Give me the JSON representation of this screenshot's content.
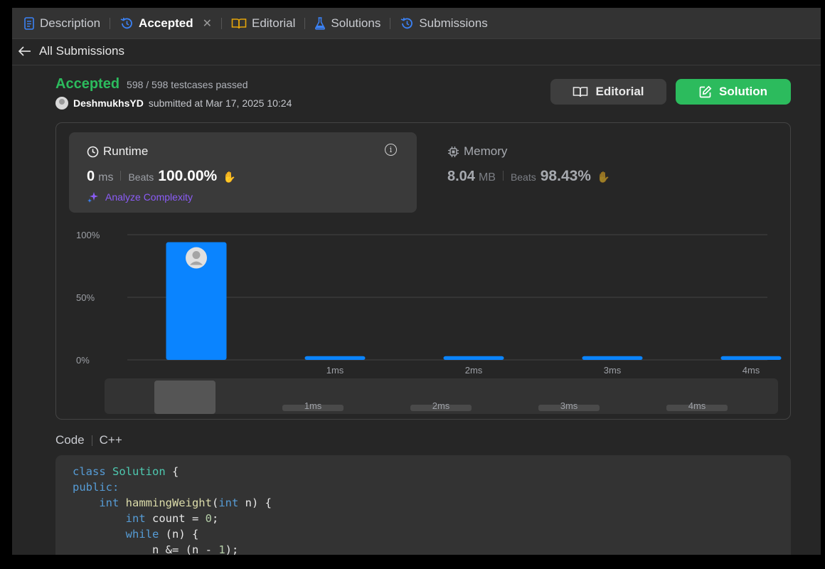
{
  "tabs": [
    {
      "label": "Description",
      "icon": "document-icon"
    },
    {
      "label": "Accepted",
      "icon": "history-icon",
      "active": true
    },
    {
      "label": "Editorial",
      "icon": "book-icon"
    },
    {
      "label": "Solutions",
      "icon": "flask-icon"
    },
    {
      "label": "Submissions",
      "icon": "history-icon"
    }
  ],
  "back_link": {
    "label": "All Submissions"
  },
  "submission": {
    "status": "Accepted",
    "testcases": "598 / 598 testcases passed",
    "username": "DeshmukhsYD",
    "submitted_text": "submitted at Mar 17, 2025 10:24"
  },
  "buttons": {
    "editorial": "Editorial",
    "solution": "Solution"
  },
  "runtime": {
    "label": "Runtime",
    "value": "0",
    "unit": "ms",
    "beats_label": "Beats",
    "beats_pct": "100.00%",
    "analyze_label": "Analyze Complexity"
  },
  "memory": {
    "label": "Memory",
    "value": "8.04",
    "unit": "MB",
    "beats_label": "Beats",
    "beats_pct": "98.43%"
  },
  "colors": {
    "accent_green": "#2cbb5d",
    "bar_blue": "#0a84ff",
    "analyze_purple": "#8b5cf6"
  },
  "chart_data": {
    "type": "bar",
    "categories": [
      "0ms",
      "1ms",
      "2ms",
      "3ms",
      "4ms"
    ],
    "tick_labels": [
      "",
      "1ms",
      "2ms",
      "3ms",
      "4ms"
    ],
    "values": [
      94,
      3,
      3,
      3,
      3
    ],
    "yticks": [
      "100%",
      "50%",
      "0%"
    ],
    "ylim": [
      0,
      100
    ],
    "grid": true,
    "highlight_index": 0,
    "overview_tick_labels": [
      "1ms",
      "2ms",
      "3ms",
      "4ms"
    ]
  },
  "code_section": {
    "label": "Code",
    "language": "C++",
    "lines": [
      [
        {
          "t": "class ",
          "c": "kw"
        },
        {
          "t": "Solution",
          "c": "ty"
        },
        {
          "t": " {",
          "c": ""
        }
      ],
      [
        {
          "t": "public:",
          "c": "kw"
        }
      ],
      [
        {
          "t": "    int ",
          "c": "kw"
        },
        {
          "t": "hammingWeight",
          "c": "fn"
        },
        {
          "t": "(",
          "c": ""
        },
        {
          "t": "int",
          "c": "kw"
        },
        {
          "t": " n) {",
          "c": ""
        }
      ],
      [
        {
          "t": "        int ",
          "c": "kw"
        },
        {
          "t": "count = ",
          "c": ""
        },
        {
          "t": "0",
          "c": "nm"
        },
        {
          "t": ";",
          "c": ""
        }
      ],
      [
        {
          "t": "        while ",
          "c": "kw"
        },
        {
          "t": "(n) {",
          "c": ""
        }
      ],
      [
        {
          "t": "            n &= (n - ",
          "c": ""
        },
        {
          "t": "1",
          "c": "nm"
        },
        {
          "t": ");",
          "c": ""
        }
      ]
    ]
  }
}
